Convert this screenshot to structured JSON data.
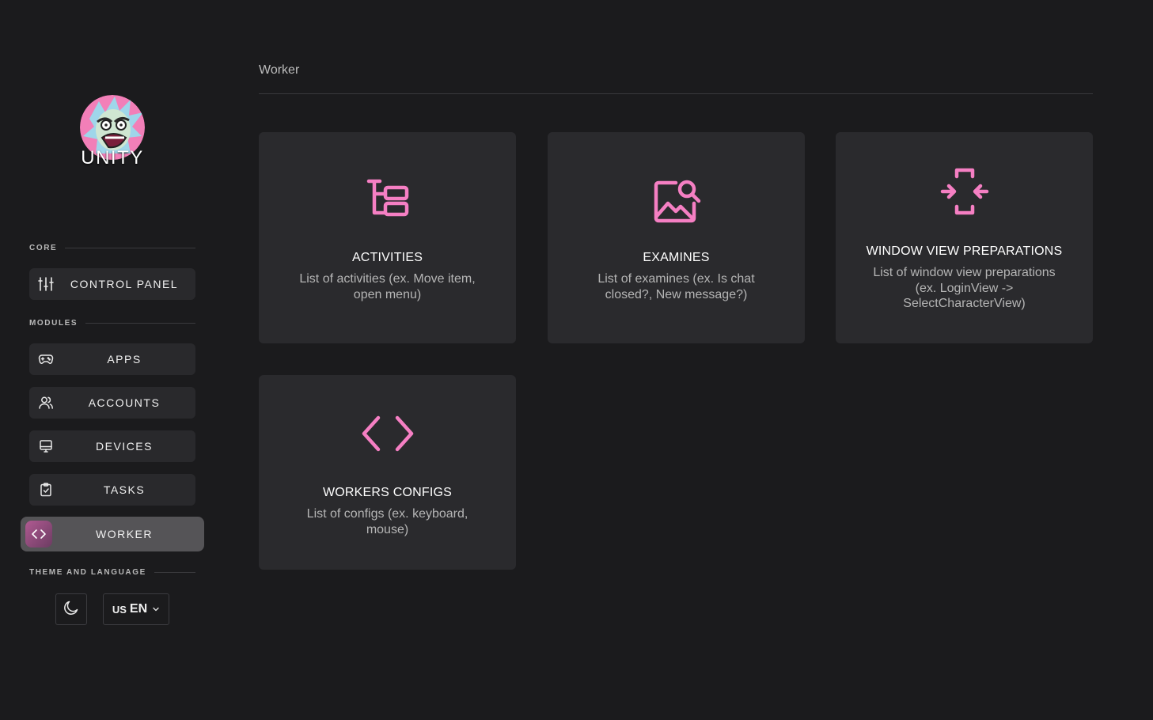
{
  "brand": {
    "name": "UNITY",
    "avatar_icon": "rick-avatar-icon"
  },
  "sidebar": {
    "core_label": "CORE",
    "control_panel": {
      "label": "CONTROL PANEL",
      "icon": "sliders-icon"
    },
    "modules_label": "MODULES",
    "modules": [
      {
        "label": "APPS",
        "icon": "gamepad-icon"
      },
      {
        "label": "ACCOUNTS",
        "icon": "users-icon"
      },
      {
        "label": "DEVICES",
        "icon": "monitor-icon"
      },
      {
        "label": "TASKS",
        "icon": "clipboard-check-icon"
      },
      {
        "label": "WORKER",
        "icon": "code-icon",
        "active": true
      }
    ],
    "theme_language_label": "THEME AND LANGUAGE",
    "theme_icon": "moon-icon",
    "language": {
      "flag": "US",
      "code": "EN",
      "icon": "chevron-down-icon"
    }
  },
  "main": {
    "title": "Worker",
    "cards": [
      {
        "title": "ACTIVITIES",
        "description": "List of activities (ex. Move item, open menu)",
        "icon": "hierarchy-icon"
      },
      {
        "title": "EXAMINES",
        "description": "List of examines (ex. Is chat closed?, New message?)",
        "icon": "image-search-icon"
      },
      {
        "title": "WINDOW VIEW PREPARATIONS",
        "description": "List of window view preparations (ex. LoginView -> SelectCharacterView)",
        "icon": "focus-arrows-icon"
      },
      {
        "title": "WORKERS CONFIGS",
        "description": "List of configs (ex. keyboard, mouse)",
        "icon": "code-icon"
      }
    ]
  },
  "colors": {
    "accent": "#f57fc3",
    "background": "#1b1b1d",
    "card": "#2a2a2d",
    "nav": "#29292c",
    "active_nav": "#555457"
  }
}
